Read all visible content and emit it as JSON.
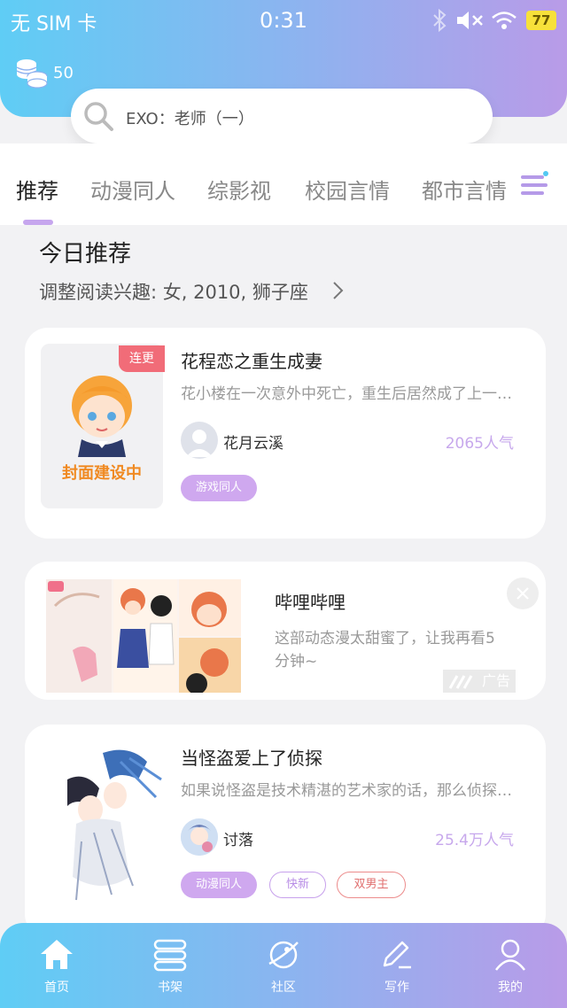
{
  "status_bar": {
    "carrier": "无 SIM 卡",
    "time": "0:31",
    "battery": "77"
  },
  "coins": {
    "count": "50"
  },
  "search": {
    "placeholder": "EXO：老师（一）"
  },
  "tabs": [
    {
      "label": "推荐"
    },
    {
      "label": "动漫同人"
    },
    {
      "label": "综影视"
    },
    {
      "label": "校园言情"
    },
    {
      "label": "都市言情"
    }
  ],
  "recommend": {
    "title": "今日推荐",
    "subtitle": "调整阅读兴趣: 女, 2010, 狮子座"
  },
  "books": [
    {
      "badge": "连更",
      "cover_text": "封面建设中",
      "title": "花程恋之重生成妻",
      "desc": "花小楼在一次意外中死亡，重生后居然成了上一…",
      "author": "花月云溪",
      "popularity": "2065人气",
      "tags": [
        "游戏同人"
      ]
    },
    {
      "title": "当怪盗爱上了侦探",
      "desc": "如果说怪盗是技术精湛的艺术家的话，那么侦探…",
      "author": "讨落",
      "popularity": "25.4万人气",
      "tags": [
        "动漫同人",
        "快新",
        "双男主"
      ]
    }
  ],
  "ad": {
    "title": "哔哩哔哩",
    "desc": "这部动态漫太甜蜜了，让我再看5分钟~",
    "mark": "广告"
  },
  "nav": [
    {
      "label": "首页",
      "icon": "home-icon"
    },
    {
      "label": "书架",
      "icon": "bookshelf-icon"
    },
    {
      "label": "社区",
      "icon": "planet-icon"
    },
    {
      "label": "写作",
      "icon": "pen-icon"
    },
    {
      "label": "我的",
      "icon": "user-icon"
    }
  ],
  "colors": {
    "accent": "#c6a6ee",
    "gradient_start": "#5fcdf5",
    "gradient_end": "#b99be8",
    "badge": "#f16c78"
  }
}
